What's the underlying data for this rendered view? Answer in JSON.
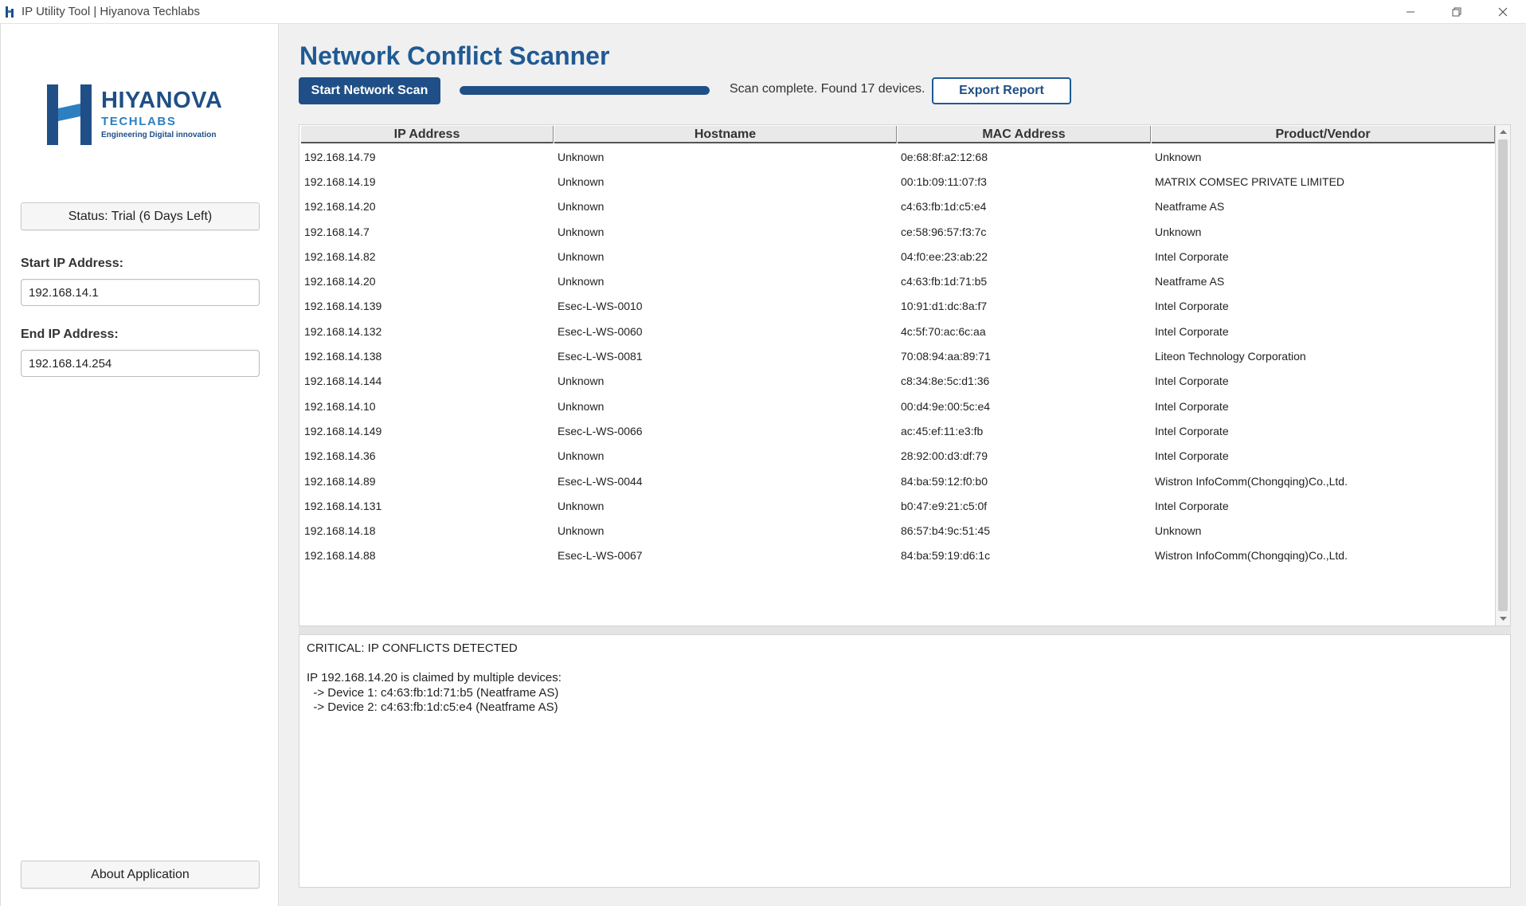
{
  "window": {
    "title": "IP Utility Tool | Hiyanova Techlabs"
  },
  "brand": {
    "name": "HIYANOVA",
    "sub": "TECHLABS",
    "tagline": "Engineering Digital innovation",
    "primary_color": "#1f4f86",
    "accent_color": "#2d7fc0"
  },
  "sidebar": {
    "status_label": "Status: Trial (6 Days Left)",
    "start_ip_label": "Start IP Address:",
    "start_ip_value": "192.168.14.1",
    "end_ip_label": "End IP Address:",
    "end_ip_value": "192.168.14.254",
    "about_label": "About Application"
  },
  "main": {
    "title": "Network Conflict Scanner",
    "scan_button": "Start Network Scan",
    "progress": 1.0,
    "scan_status": "Scan complete. Found 17 devices.",
    "export_button": "Export Report"
  },
  "table": {
    "columns": [
      "IP Address",
      "Hostname",
      "MAC Address",
      "Product/Vendor"
    ],
    "rows": [
      [
        "192.168.14.79",
        "Unknown",
        "0e:68:8f:a2:12:68",
        "Unknown"
      ],
      [
        "192.168.14.19",
        "Unknown",
        "00:1b:09:11:07:f3",
        "MATRIX COMSEC PRIVATE LIMITED"
      ],
      [
        "192.168.14.20",
        "Unknown",
        "c4:63:fb:1d:c5:e4",
        "Neatframe AS"
      ],
      [
        "192.168.14.7",
        "Unknown",
        "ce:58:96:57:f3:7c",
        "Unknown"
      ],
      [
        "192.168.14.82",
        "Unknown",
        "04:f0:ee:23:ab:22",
        "Intel Corporate"
      ],
      [
        "192.168.14.20",
        "Unknown",
        "c4:63:fb:1d:71:b5",
        "Neatframe AS"
      ],
      [
        "192.168.14.139",
        "Esec-L-WS-0010",
        "10:91:d1:dc:8a:f7",
        "Intel Corporate"
      ],
      [
        "192.168.14.132",
        "Esec-L-WS-0060",
        "4c:5f:70:ac:6c:aa",
        "Intel Corporate"
      ],
      [
        "192.168.14.138",
        "Esec-L-WS-0081",
        "70:08:94:aa:89:71",
        "Liteon Technology Corporation"
      ],
      [
        "192.168.14.144",
        "Unknown",
        "c8:34:8e:5c:d1:36",
        "Intel Corporate"
      ],
      [
        "192.168.14.10",
        "Unknown",
        "00:d4:9e:00:5c:e4",
        "Intel Corporate"
      ],
      [
        "192.168.14.149",
        "Esec-L-WS-0066",
        "ac:45:ef:11:e3:fb",
        "Intel Corporate"
      ],
      [
        "192.168.14.36",
        "Unknown",
        "28:92:00:d3:df:79",
        "Intel Corporate"
      ],
      [
        "192.168.14.89",
        "Esec-L-WS-0044",
        "84:ba:59:12:f0:b0",
        "Wistron InfoComm(Chongqing)Co.,Ltd."
      ],
      [
        "192.168.14.131",
        "Unknown",
        "b0:47:e9:21:c5:0f",
        "Intel Corporate"
      ],
      [
        "192.168.14.18",
        "Unknown",
        "86:57:b4:9c:51:45",
        "Unknown"
      ],
      [
        "192.168.14.88",
        "Esec-L-WS-0067",
        "84:ba:59:19:d6:1c",
        "Wistron InfoComm(Chongqing)Co.,Ltd."
      ]
    ]
  },
  "log": {
    "lines": [
      "CRITICAL: IP CONFLICTS DETECTED",
      "",
      "IP 192.168.14.20 is claimed by multiple devices:",
      "  -> Device 1: c4:63:fb:1d:71:b5 (Neatframe AS)",
      "  -> Device 2: c4:63:fb:1d:c5:e4 (Neatframe AS)"
    ]
  }
}
